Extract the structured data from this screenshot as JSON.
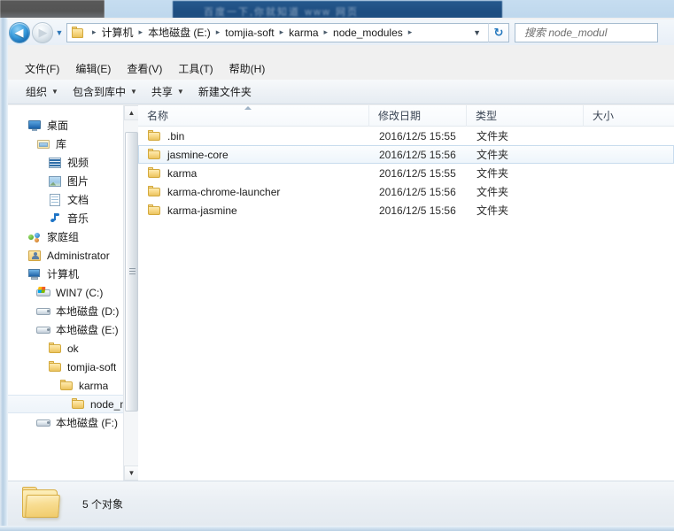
{
  "window": {
    "background_banner_text": "百度一下,你就知道 www 网页"
  },
  "address_bar": {
    "back_label": "◀",
    "forward_label": "▶",
    "history_caret": "▼",
    "folder_icon": "folder-icon",
    "breadcrumbs": [
      "计算机",
      "本地磁盘 (E:)",
      "tomjia-soft",
      "karma",
      "node_modules"
    ],
    "separator": "▸",
    "dropdown_caret": "▼",
    "refresh_label": "↻"
  },
  "search": {
    "placeholder": "搜索 node_modul"
  },
  "menu": {
    "items": [
      {
        "label": "文件(F)"
      },
      {
        "label": "编辑(E)"
      },
      {
        "label": "查看(V)"
      },
      {
        "label": "工具(T)"
      },
      {
        "label": "帮助(H)"
      }
    ]
  },
  "toolbar": {
    "items": [
      {
        "label": "组织",
        "caret": "▼"
      },
      {
        "label": "包含到库中",
        "caret": "▼"
      },
      {
        "label": "共享",
        "caret": "▼"
      },
      {
        "label": "新建文件夹",
        "caret": ""
      }
    ]
  },
  "nav_pane": {
    "items": [
      {
        "label": "桌面",
        "icon": "desktop-icon",
        "indent": 0,
        "selected": false
      },
      {
        "label": "库",
        "icon": "library-icon",
        "indent": 1,
        "selected": false
      },
      {
        "label": "视频",
        "icon": "video-icon",
        "indent": 2,
        "selected": false
      },
      {
        "label": "图片",
        "icon": "picture-icon",
        "indent": 2,
        "selected": false
      },
      {
        "label": "文档",
        "icon": "document-icon",
        "indent": 2,
        "selected": false
      },
      {
        "label": "音乐",
        "icon": "music-icon",
        "indent": 2,
        "selected": false
      },
      {
        "label": "家庭组",
        "icon": "homegroup-icon",
        "indent": 1,
        "selected": false
      },
      {
        "label": "Administrator",
        "icon": "user-icon",
        "indent": 1,
        "selected": false
      },
      {
        "label": "计算机",
        "icon": "computer-icon",
        "indent": 1,
        "selected": false
      },
      {
        "label": "WIN7 (C:)",
        "icon": "windows-drive-icon",
        "indent": 2,
        "selected": false
      },
      {
        "label": "本地磁盘 (D:)",
        "icon": "drive-icon",
        "indent": 2,
        "selected": false
      },
      {
        "label": "本地磁盘 (E:)",
        "icon": "drive-icon",
        "indent": 2,
        "selected": false
      },
      {
        "label": "ok",
        "icon": "folder-icon",
        "indent": 3,
        "selected": false
      },
      {
        "label": "tomjia-soft",
        "icon": "folder-icon",
        "indent": 3,
        "selected": false
      },
      {
        "label": "karma",
        "icon": "folder-icon",
        "indent": 4,
        "selected": false
      },
      {
        "label": "node_mo",
        "icon": "folder-icon",
        "indent": 5,
        "selected": true
      },
      {
        "label": "本地磁盘 (F:)",
        "icon": "drive-icon",
        "indent": 2,
        "selected": false
      }
    ],
    "scroll_up": "▲",
    "scroll_down": "▼"
  },
  "file_list": {
    "columns": [
      {
        "label": "名称",
        "key": "name"
      },
      {
        "label": "修改日期",
        "key": "date"
      },
      {
        "label": "类型",
        "key": "type"
      },
      {
        "label": "大小",
        "key": "size"
      }
    ],
    "sort_column": "名称",
    "sort_direction": "ascending",
    "rows": [
      {
        "name": ".bin",
        "date": "2016/12/5 15:55",
        "type": "文件夹",
        "size": "",
        "selected": false
      },
      {
        "name": "jasmine-core",
        "date": "2016/12/5 15:56",
        "type": "文件夹",
        "size": "",
        "selected": true
      },
      {
        "name": "karma",
        "date": "2016/12/5 15:55",
        "type": "文件夹",
        "size": "",
        "selected": false
      },
      {
        "name": "karma-chrome-launcher",
        "date": "2016/12/5 15:56",
        "type": "文件夹",
        "size": "",
        "selected": false
      },
      {
        "name": "karma-jasmine",
        "date": "2016/12/5 15:56",
        "type": "文件夹",
        "size": "",
        "selected": false
      }
    ],
    "scroll_up": "▲",
    "scroll_down": "▼"
  },
  "details_pane": {
    "item_count": "5 个对象"
  },
  "colors": {
    "accent": "#2176bd",
    "selection_border": "#c8dcee",
    "folder_yellow": "#f8d987",
    "window_frame": "#b8cfe3"
  }
}
